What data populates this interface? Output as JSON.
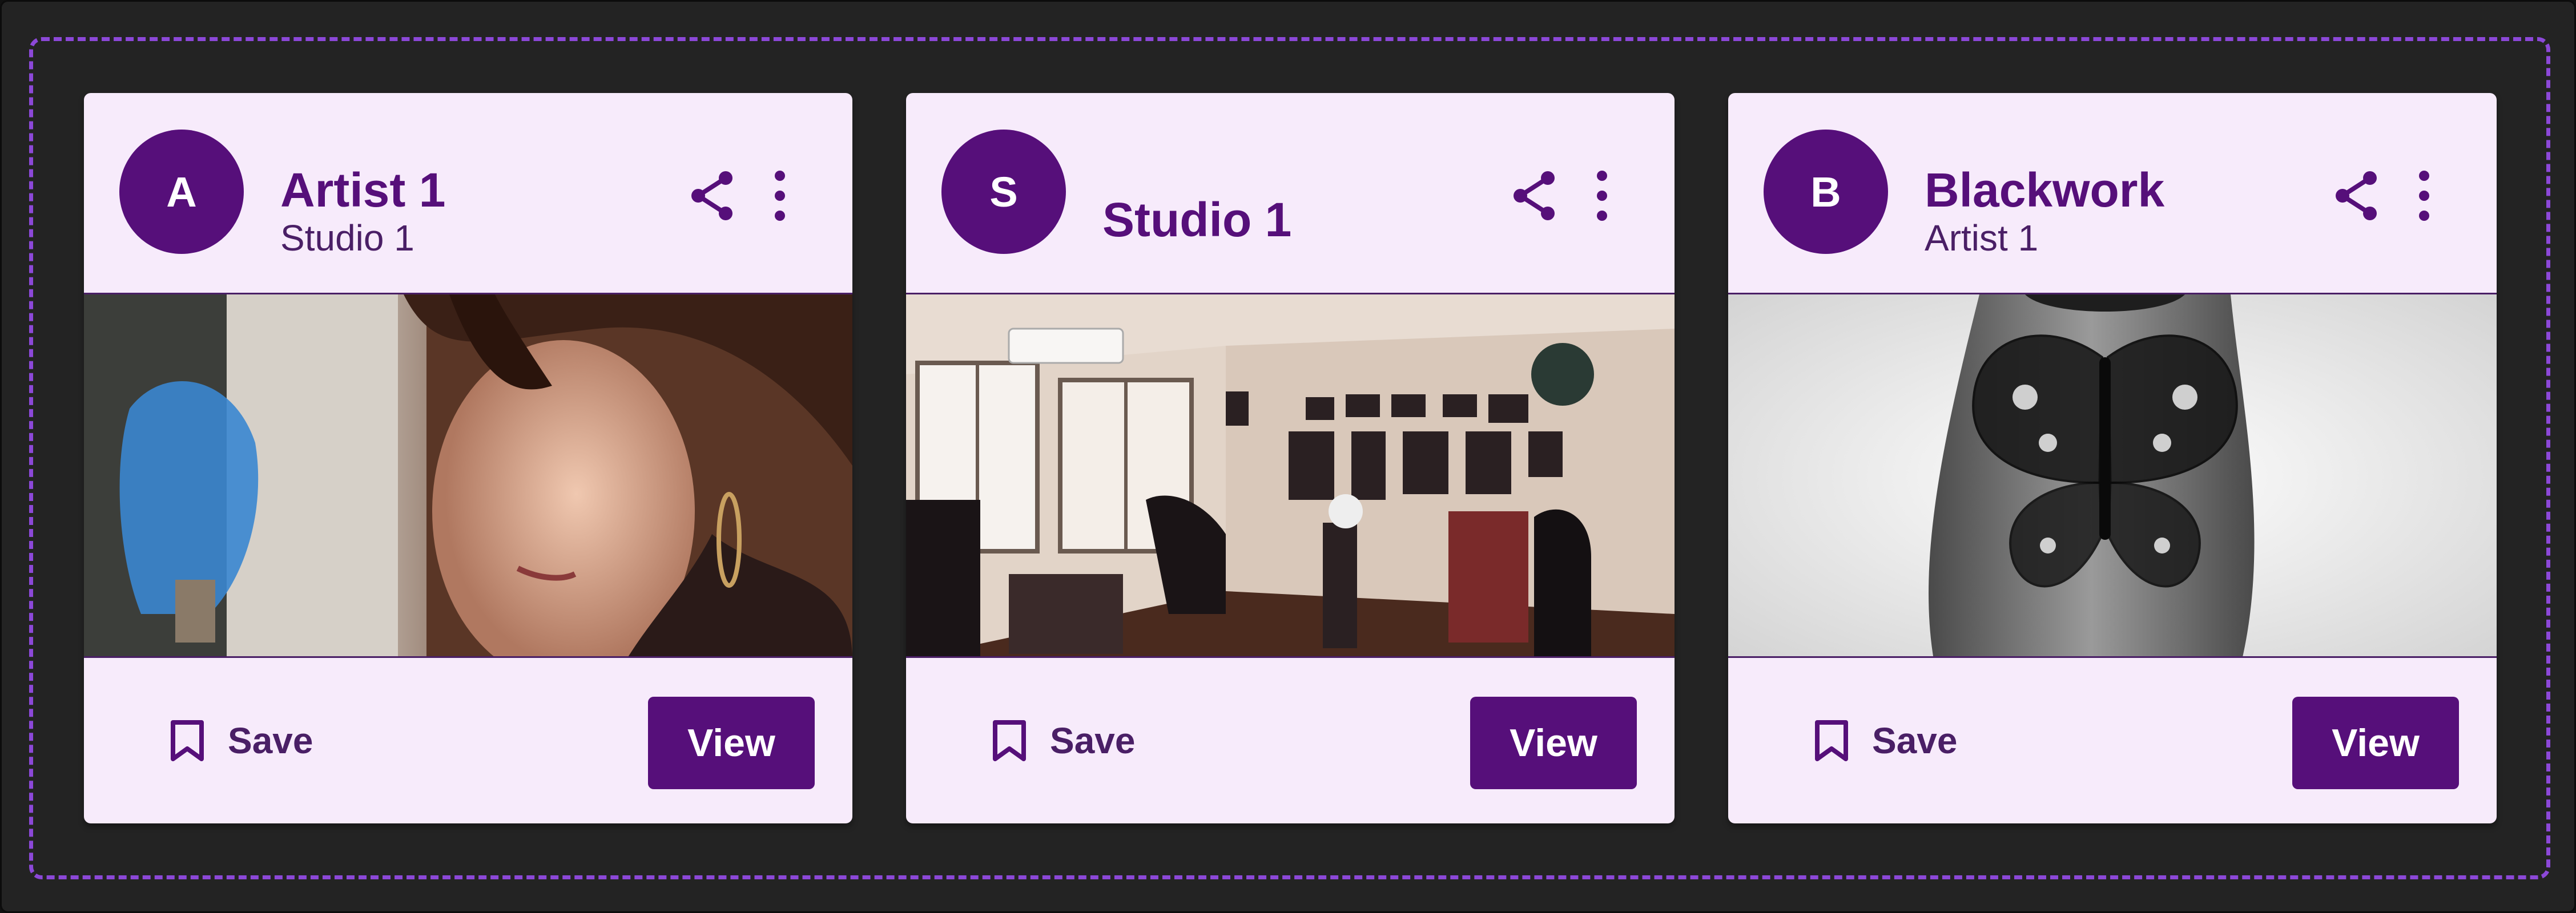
{
  "cards": [
    {
      "avatar_letter": "A",
      "title": "Artist 1",
      "subtitle": "Studio 1",
      "image_alt": "tattoo artist working",
      "share_icon": "share-icon",
      "more_icon": "more-vert-icon",
      "save_label": "Save",
      "view_label": "View"
    },
    {
      "avatar_letter": "S",
      "title": "Studio 1",
      "subtitle": "",
      "image_alt": "tattoo studio interior",
      "share_icon": "share-icon",
      "more_icon": "more-vert-icon",
      "save_label": "Save",
      "view_label": "View"
    },
    {
      "avatar_letter": "B",
      "title": "Blackwork",
      "subtitle": "Artist 1",
      "image_alt": "butterfly hand tattoo",
      "share_icon": "share-icon",
      "more_icon": "more-vert-icon",
      "save_label": "Save",
      "view_label": "View"
    }
  ],
  "colors": {
    "primary": "#560f7a",
    "card_background": "#f7ebfb",
    "frame_background": "#232323",
    "dashed_border": "#8c48d8"
  }
}
